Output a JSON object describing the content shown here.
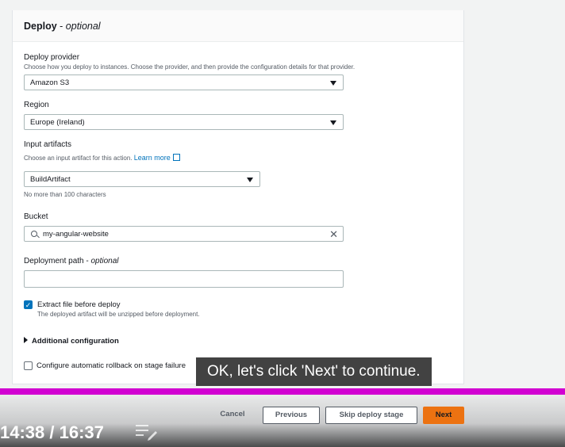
{
  "section": {
    "title": "Deploy",
    "title_suffix": "optional"
  },
  "deploy_provider": {
    "label": "Deploy provider",
    "description": "Choose how you deploy to instances. Choose the provider, and then provide the configuration details for that provider.",
    "value": "Amazon S3"
  },
  "region": {
    "label": "Region",
    "value": "Europe (Ireland)"
  },
  "input_artifacts": {
    "label": "Input artifacts",
    "description": "Choose an input artifact for this action.",
    "learn_more": "Learn more",
    "value": "BuildArtifact",
    "hint": "No more than 100 characters"
  },
  "bucket": {
    "label": "Bucket",
    "value": "my-angular-website"
  },
  "deployment_path": {
    "label": "Deployment path",
    "label_suffix": "optional",
    "value": ""
  },
  "extract": {
    "label": "Extract file before deploy",
    "description": "The deployed artifact will be unzipped before deployment.",
    "checked": true
  },
  "additional_config": {
    "label": "Additional configuration"
  },
  "rollback": {
    "label": "Configure automatic rollback on stage failure",
    "checked": false
  },
  "caption": "OK, let's click 'Next' to continue.",
  "footer": {
    "cancel": "Cancel",
    "previous": "Previous",
    "skip": "Skip deploy stage",
    "next": "Next"
  },
  "player": {
    "time": "14:38 / 16:37"
  },
  "colors": {
    "accent": "#0073bb",
    "primary_button": "#ec7211",
    "progress_bar": "#d100d1"
  }
}
